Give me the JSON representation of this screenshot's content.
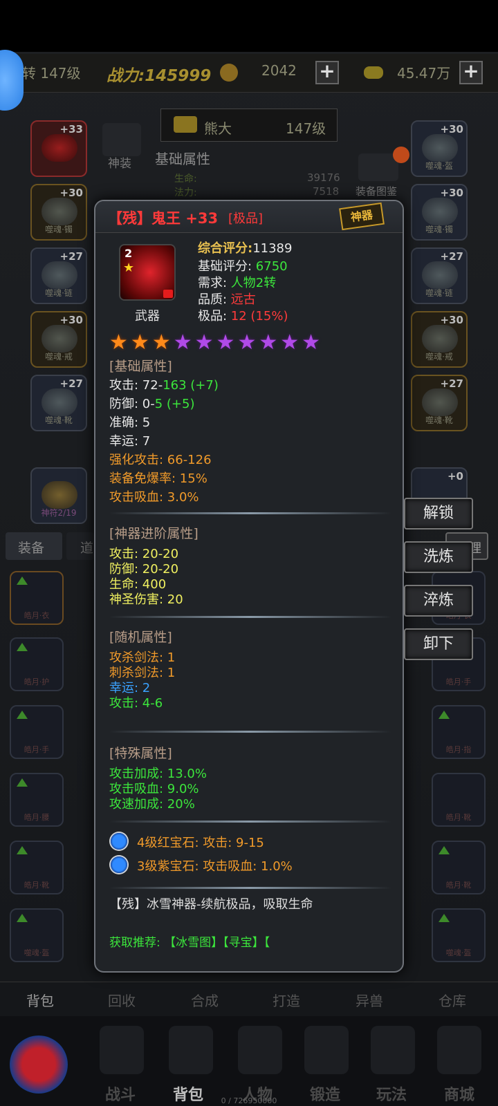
{
  "header": {
    "rebirth_level": "转 147级",
    "power": "战力:145999",
    "coins": "2042",
    "gold": "45.47万"
  },
  "character": {
    "name": "熊大",
    "level": "147级"
  },
  "behind": {
    "god_equip": "神装",
    "basic_attr": "基础属性",
    "hp_label": "生命:",
    "hp_value": "39176",
    "mp_label": "法力:",
    "mp_value": "7518",
    "equip_atlas": "装备图鉴",
    "left_slots": [
      {
        "level": "+33",
        "name": ""
      },
      {
        "level": "+30",
        "name": "噬魂·镯"
      },
      {
        "level": "+27",
        "name": "噬魂·链"
      },
      {
        "level": "+30",
        "name": "噬魂·戒"
      },
      {
        "level": "+27",
        "name": "噬魂·靴"
      }
    ],
    "right_slots": [
      {
        "level": "+30",
        "name": "噬魂·盔"
      },
      {
        "level": "+30",
        "name": "噬魂·镯"
      },
      {
        "level": "+27",
        "name": "噬魂·链"
      },
      {
        "level": "+30",
        "name": "噬魂·戒"
      },
      {
        "level": "+27",
        "name": "噬魂·靴"
      }
    ],
    "medal": "神符2/19",
    "right_bottom_slot_level": "+0",
    "tab_equip": "装备",
    "tab_item": "道",
    "sort": "整理",
    "grid_left": [
      "皓月·衣",
      "皓月·护",
      "皓月·手",
      "皓月·腰",
      "皓月·靴",
      "噬魂·盔"
    ],
    "grid_right": [
      "皓月·衣",
      "皓月·手",
      "皓月·指",
      "皓月·靴",
      "皓月·靴",
      "噬魂·盔"
    ]
  },
  "popup": {
    "name": "【残】鬼王 +33",
    "quality_tag": "[极品]",
    "badge": "神器",
    "icon_level": "2",
    "item_type": "武器",
    "score_label": "综合评分:",
    "score_value": "11389",
    "base_score_label": "基础评分: ",
    "base_score_value": "6750",
    "require_label": "需求: ",
    "require_value": "人物2转",
    "grade_label": "品质: ",
    "grade_value": "远古",
    "excellent_label": "极品: ",
    "excellent_value": "12 (15%)",
    "stars_total": 10,
    "stars_orange": 3,
    "basic": {
      "title": "[基础属性]",
      "attack_label": "攻击: 72-",
      "attack_value": "163 (+7)",
      "defense_label": "防御: 0-",
      "defense_value": "5 (+5)",
      "accuracy": "准确: 5",
      "luck": "幸运: 7",
      "enh_attack": "强化攻击: 66-126",
      "anti_burst": "装备免爆率: 15%",
      "lifesteal": "攻击吸血: 3.0%"
    },
    "advance": {
      "title": "[神器进阶属性]",
      "lines": [
        "攻击: 20-20",
        "防御: 20-20",
        "生命: 400",
        "神圣伤害: 20"
      ]
    },
    "random": {
      "title": "[随机属性]",
      "lines": [
        "攻杀剑法: 1",
        "刺杀剑法: 1",
        "幸运: 2",
        "攻击: 4-6"
      ]
    },
    "special": {
      "title": "[特殊属性]",
      "lines": [
        "攻击加成: 13.0%",
        "攻击吸血: 9.0%",
        "攻速加成: 20%"
      ]
    },
    "gems": [
      "4级红宝石: 攻击: 9-15",
      "3级紫宝石: 攻击吸血: 1.0%"
    ],
    "description": "【残】冰雪神器-续航极品，吸取生命",
    "recommend": "获取推荐: 【冰雪图】【寻宝】【"
  },
  "actions": {
    "unlock": "解锁",
    "refine": "洗炼",
    "temper": "淬炼",
    "unequip": "卸下"
  },
  "bottom_tabs": [
    "背包",
    "回收",
    "合成",
    "打造",
    "异兽",
    "仓库"
  ],
  "nav": [
    "战斗",
    "背包",
    "人物",
    "锻造",
    "玩法",
    "商城"
  ],
  "exp_text": "0 / 726950000",
  "colors": {
    "popup_bg": "#202327",
    "name_red": "#ff3a3a",
    "green": "#3ce63c",
    "orange": "#f09a2a",
    "yellow": "#f0f060",
    "blue": "#3aa2ff"
  }
}
